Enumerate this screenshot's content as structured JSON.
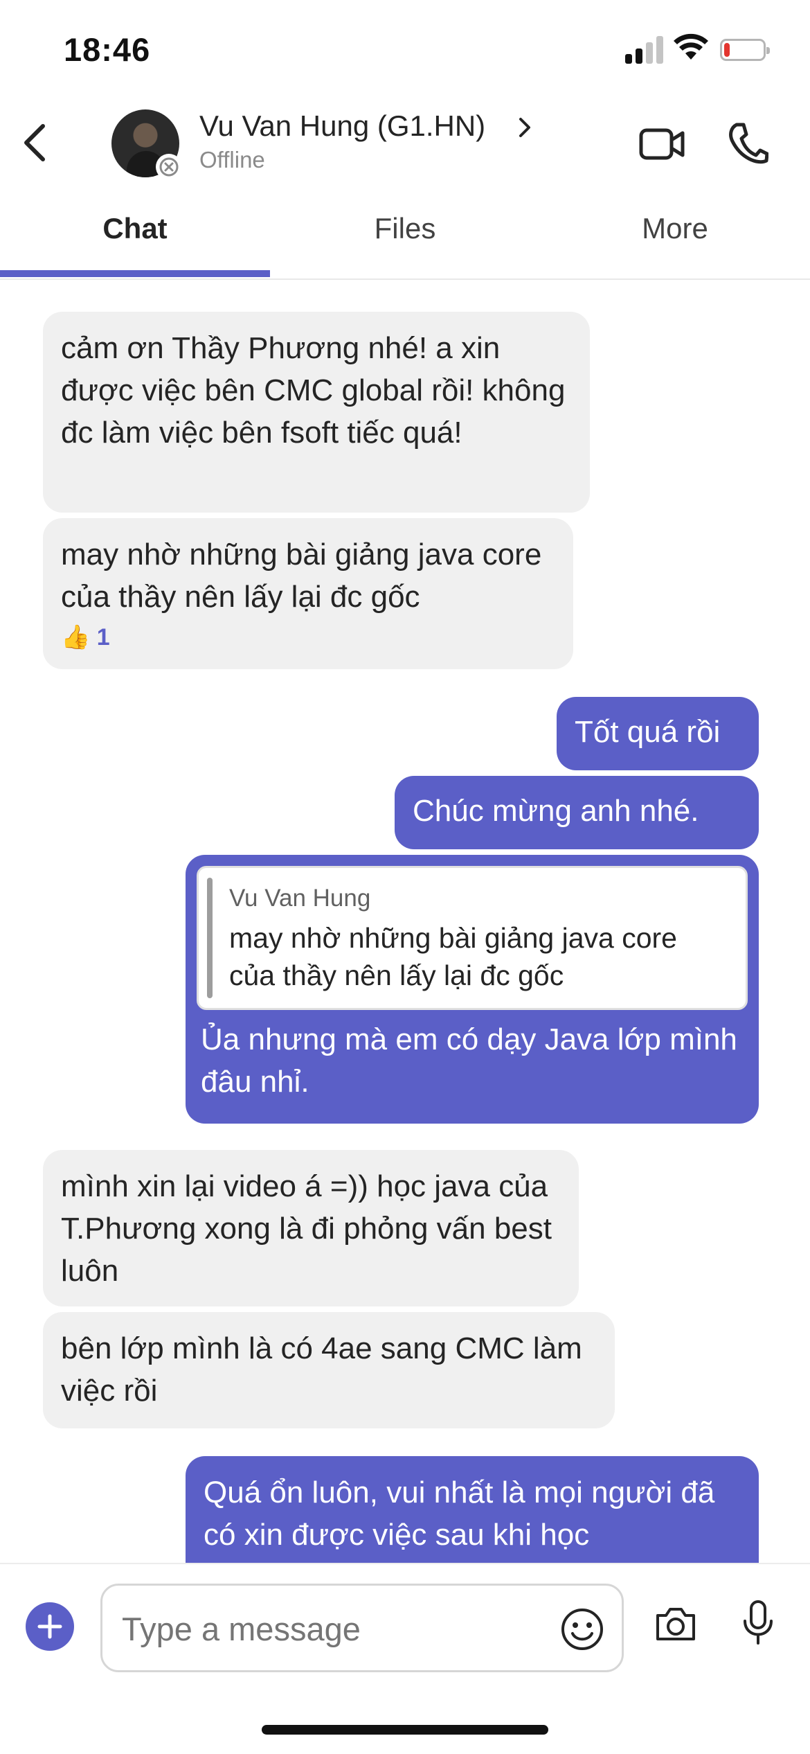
{
  "status_bar": {
    "time": "18:46",
    "battery_level": 0.15
  },
  "header": {
    "contact_name": "Vu Van Hung (G1.HN)",
    "contact_status": "Offline"
  },
  "tabs": [
    {
      "label": "Chat",
      "active": true
    },
    {
      "label": "Files",
      "active": false
    },
    {
      "label": "More",
      "active": false
    }
  ],
  "accent_color": "#5b5fc7",
  "messages": [
    {
      "direction": "incoming",
      "text": "cảm ơn Thầy Phương nhé! a xin được việc bên CMC global rồi! không đc làm việc bên fsoft tiếc quá!"
    },
    {
      "direction": "incoming",
      "text": "may nhờ những bài giảng java core của thầy nên lấy lại đc gốc",
      "reaction": {
        "emoji": "👍",
        "count": "1"
      }
    },
    {
      "direction": "outgoing",
      "text": "Tốt quá rồi"
    },
    {
      "direction": "outgoing",
      "text": "Chúc mừng anh nhé."
    },
    {
      "direction": "outgoing",
      "quote": {
        "author": "Vu Van Hung",
        "text": "may nhờ những bài giảng java core của thầy nên lấy lại đc gốc"
      },
      "text": "Ủa nhưng mà em có dạy Java lớp mình đâu nhỉ."
    },
    {
      "direction": "incoming",
      "text": "mình xin lại video á =)) học java của T.Phương xong là đi phỏng vấn best luôn"
    },
    {
      "direction": "incoming",
      "text": "bên lớp mình là có 4ae sang CMC làm việc rồi"
    },
    {
      "direction": "outgoing",
      "text": "Quá ổn luôn, vui nhất là mọi người đã có xin được việc sau khi học"
    }
  ],
  "compose": {
    "placeholder": "Type a message"
  }
}
